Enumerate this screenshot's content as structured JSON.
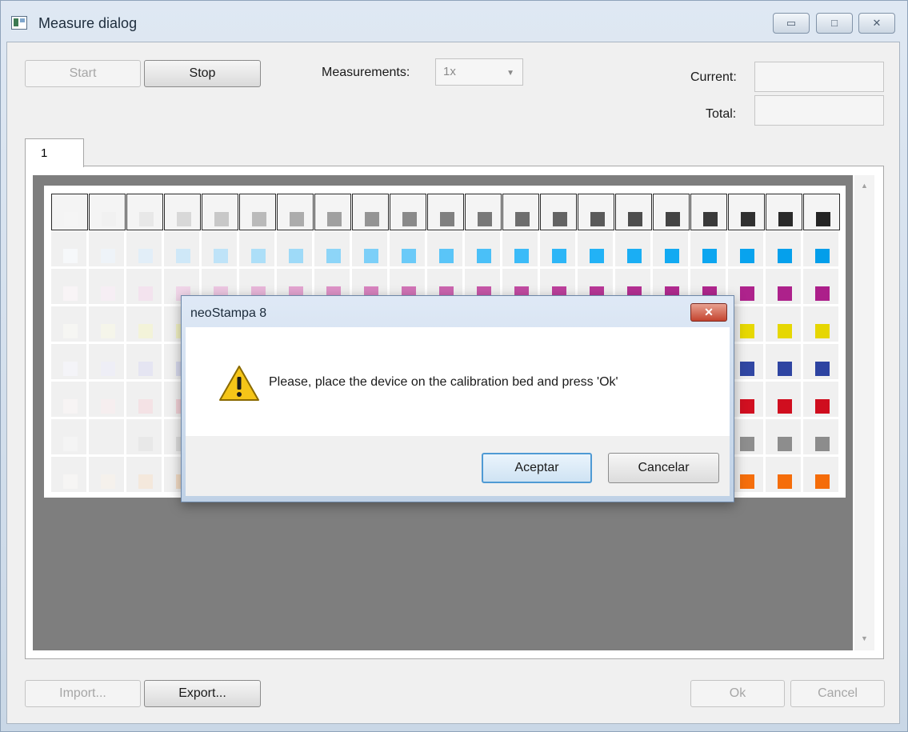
{
  "window": {
    "title": "Measure dialog",
    "minimize_glyph": "▭",
    "maximize_glyph": "□",
    "close_glyph": "✕"
  },
  "toolbar": {
    "start_label": "Start",
    "stop_label": "Stop",
    "measurements_label": "Measurements:",
    "measurements_value": "1x",
    "dropdown_arrow": "▼",
    "current_label": "Current:",
    "total_label": "Total:",
    "current_value": "",
    "total_value": ""
  },
  "tabs": [
    {
      "label": "1"
    }
  ],
  "scrollbar": {
    "up_arrow": "▲",
    "down_arrow": "▼"
  },
  "patch_chart": {
    "columns": 21,
    "rows": [
      {
        "name": "gray-ramp",
        "colors": [
          "#f5f5f5",
          "#f1f1f1",
          "#e8e8e8",
          "#d8d8d8",
          "#c8c8c8",
          "#bababa",
          "#acacac",
          "#a0a0a0",
          "#949494",
          "#8a8a8a",
          "#808080",
          "#787878",
          "#6e6e6e",
          "#646464",
          "#5a5a5a",
          "#4e4e4e",
          "#444444",
          "#3a3a3a",
          "#303030",
          "#2a2a2a",
          "#242424"
        ]
      },
      {
        "name": "cyan-ramp",
        "colors": [
          "#f6f8fa",
          "#eef3f8",
          "#e2eef8",
          "#cfe8f8",
          "#bfe3f8",
          "#addff8",
          "#9edaf8",
          "#8dd5f8",
          "#7ccff8",
          "#6bcaf8",
          "#5ac5f8",
          "#4ac0f8",
          "#3bbbf8",
          "#2db6f7",
          "#22b2f6",
          "#1aaef4",
          "#12aaf2",
          "#0ca6f0",
          "#08a3ee",
          "#05a0ec",
          "#039eea"
        ]
      },
      {
        "name": "magenta-ramp",
        "colors": [
          "#f8f4f6",
          "#f6eef4",
          "#f3e3ee",
          "#f0d5e8",
          "#ecc6e1",
          "#e8b6d9",
          "#e3a4d0",
          "#de93c7",
          "#d883bf",
          "#d274b7",
          "#cc65af",
          "#c757a8",
          "#c24ba2",
          "#bd409c",
          "#b93797",
          "#b52f93",
          "#b22a90",
          "#b0268e",
          "#ae238c",
          "#ad218b",
          "#ac1f8a"
        ]
      },
      {
        "name": "yellow-ramp",
        "colors": [
          "#f6f6f3",
          "#f5f5ea",
          "#f3f3d9",
          "#f2f2c4",
          "#f1f0ae",
          "#f0ee99",
          "#efec84",
          "#eeea70",
          "#ede75c",
          "#ece54b",
          "#ebe33b",
          "#eae12e",
          "#e9df22",
          "#e8dd18",
          "#e8dc10",
          "#e8db0a",
          "#e7da06",
          "#e7d904",
          "#e7d803",
          "#e6d702",
          "#e6d601"
        ]
      },
      {
        "name": "blue-ramp",
        "colors": [
          "#f4f4f8",
          "#eeeef6",
          "#e5e5f2",
          "#d8daee",
          "#cacee8",
          "#bbc1e2",
          "#aab3dc",
          "#9aa5d5",
          "#8a97cf",
          "#7b8ac8",
          "#6d7dc2",
          "#6072bc",
          "#5567b6",
          "#4b5eb1",
          "#4357ad",
          "#3c51aa",
          "#374ca7",
          "#3449a5",
          "#3147a3",
          "#2f45a2",
          "#2d43a1"
        ]
      },
      {
        "name": "red-ramp",
        "colors": [
          "#f7f4f4",
          "#f6eeef",
          "#f4e2e5",
          "#f2d2d8",
          "#f0c0c9",
          "#edaeb9",
          "#eb9ba9",
          "#e88898",
          "#e57587",
          "#e26376",
          "#df5266",
          "#dc4358",
          "#da364b",
          "#d82b40",
          "#d62236",
          "#d41b2e",
          "#d31628",
          "#d21224",
          "#d11021",
          "#d00e1f",
          "#cf0d1e"
        ]
      },
      {
        "name": "mid-gray-ramp",
        "colors": [
          "#f4f4f4",
          "#f0f0f0",
          "#e8e8e8",
          "#dedede",
          "#d4d4d4",
          "#cbcbcb",
          "#c2c2c2",
          "#bababa",
          "#b3b3b3",
          "#adadad",
          "#a7a7a7",
          "#a2a2a2",
          "#9e9e9e",
          "#9a9a9a",
          "#979797",
          "#949494",
          "#929292",
          "#909090",
          "#8e8e8e",
          "#8d8d8d",
          "#8c8c8c"
        ]
      },
      {
        "name": "orange-ramp",
        "colors": [
          "#f6f5f4",
          "#f5f1ec",
          "#f4e8dc",
          "#f3dcc6",
          "#f3ceac",
          "#f3c093",
          "#f3b27b",
          "#f3a566",
          "#f39a54",
          "#f49044",
          "#f48837",
          "#f4812c",
          "#f47b23",
          "#f5771c",
          "#f57416",
          "#f57212",
          "#f5700f",
          "#f56f0d",
          "#f56e0b",
          "#f56d0a",
          "#f56c09"
        ]
      }
    ]
  },
  "footer": {
    "import_label": "Import...",
    "export_label": "Export...",
    "ok_label": "Ok",
    "cancel_label": "Cancel"
  },
  "dialog": {
    "title": "neoStampa 8",
    "close_glyph": "✕",
    "message": "Please, place the device on the calibration bed and press 'Ok'",
    "accept_label": "Aceptar",
    "cancel_label": "Cancelar"
  },
  "colors": {
    "window_frame": "#c9d6e4",
    "canvas_gray": "#7e7e7e",
    "dialog_default_border": "#4f9ad4",
    "warning_yellow": "#f5c518"
  }
}
